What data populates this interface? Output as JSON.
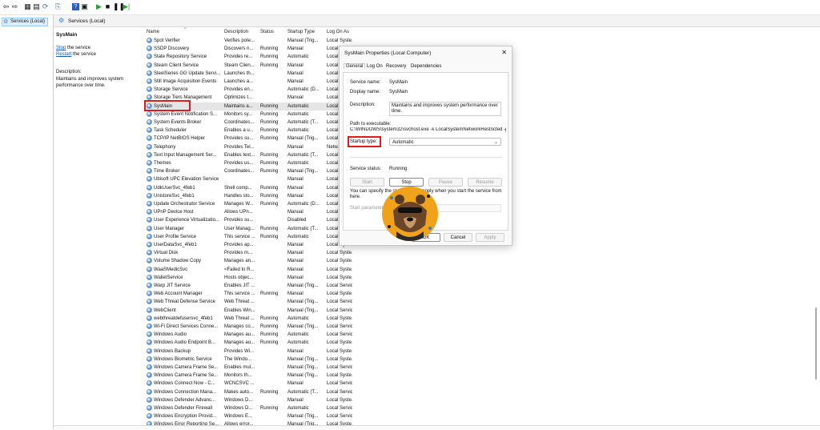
{
  "toolbar": {
    "icons": [
      "back-arrow-icon",
      "forward-arrow-icon",
      "console-tree-icon",
      "list-view-icon",
      "refresh-icon",
      "export-icon",
      "help-icon",
      "properties-icon",
      "play-icon",
      "stop-icon",
      "pause-icon",
      "resume-icon"
    ],
    "glyphs": [
      "⇦",
      "⇨",
      "▦",
      "▤",
      "⟳",
      "⎘",
      "?",
      "▣",
      "▶",
      "■",
      "❚❚",
      "▶|"
    ]
  },
  "tree": {
    "item_label": "Services (Local)"
  },
  "main": {
    "header_title": "Services (Local)"
  },
  "description_pane": {
    "service_title": "SysMain",
    "stop_link": "Stop",
    "stop_suffix": " the service",
    "restart_link": "Restart",
    "restart_suffix": " the service",
    "description_label": "Description:",
    "description_text": "Maintains and improves system performance over time."
  },
  "table": {
    "headers": {
      "name": "Name",
      "description": "Description",
      "status": "Status",
      "startup": "Startup Type",
      "logon": "Log On As"
    },
    "rows": [
      {
        "name": "Spot Verifier",
        "desc": "Verifies pote...",
        "status": "",
        "startup": "Manual (Trig...",
        "logon": "Local Syste..."
      },
      {
        "name": "SSDP Discovery",
        "desc": "Discovers n...",
        "status": "Running",
        "startup": "Manual",
        "logon": "Local Service"
      },
      {
        "name": "State Repository Service",
        "desc": "Provides re...",
        "status": "Running",
        "startup": "Automatic",
        "logon": "Local Syste..."
      },
      {
        "name": "Steam Client Service",
        "desc": "Steam Clien...",
        "status": "Running",
        "startup": "Manual",
        "logon": "Local Syste..."
      },
      {
        "name": "SteelSeries GG Update Servi...",
        "desc": "Launches th...",
        "status": "",
        "startup": "Manual",
        "logon": "Local Syste..."
      },
      {
        "name": "Still Image Acquisition Events",
        "desc": "Launches a...",
        "status": "",
        "startup": "Manual",
        "logon": "Local Syste..."
      },
      {
        "name": "Storage Service",
        "desc": "Provides en...",
        "status": "",
        "startup": "Automatic (D...",
        "logon": "Local Syste..."
      },
      {
        "name": "Storage Tiers Management",
        "desc": "Optimizes t...",
        "status": "",
        "startup": "Manual",
        "logon": "Local Syste..."
      },
      {
        "name": "SysMain",
        "desc": "Maintains a...",
        "status": "Running",
        "startup": "Automatic",
        "logon": "Local Syste..."
      },
      {
        "name": "System Event Notification S...",
        "desc": "Monitors sy...",
        "status": "Running",
        "startup": "Automatic",
        "logon": "Local Syste..."
      },
      {
        "name": "System Events Broker",
        "desc": "Coordinates...",
        "status": "Running",
        "startup": "Automatic (T...",
        "logon": "Local Syste..."
      },
      {
        "name": "Task Scheduler",
        "desc": "Enables a u...",
        "status": "Running",
        "startup": "Automatic",
        "logon": "Local Syste..."
      },
      {
        "name": "TCP/IP NetBIOS Helper",
        "desc": "Provides su...",
        "status": "Running",
        "startup": "Manual (Trig...",
        "logon": "Local Service"
      },
      {
        "name": "Telephony",
        "desc": "Provides Tel...",
        "status": "",
        "startup": "Manual",
        "logon": "Netw..."
      },
      {
        "name": "Text Input Management Ser...",
        "desc": "Enables text...",
        "status": "Running",
        "startup": "Automatic (T...",
        "logon": "Local Syste..."
      },
      {
        "name": "Themes",
        "desc": "Provides us...",
        "status": "Running",
        "startup": "Automatic",
        "logon": "Local Syste..."
      },
      {
        "name": "Time Broker",
        "desc": "Coordinates...",
        "status": "Running",
        "startup": "Manual (Trig...",
        "logon": "Local Service"
      },
      {
        "name": "Ubisoft UPC Elevation Service",
        "desc": "",
        "status": "",
        "startup": "Manual",
        "logon": "Local Syste..."
      },
      {
        "name": "UdkUserSvc_4feb1",
        "desc": "Shell comp...",
        "status": "Running",
        "startup": "Manual",
        "logon": "Local Syste..."
      },
      {
        "name": "UnistoreSvc_4feb1",
        "desc": "Handles sto...",
        "status": "Running",
        "startup": "Manual",
        "logon": "Local Syste..."
      },
      {
        "name": "Update Orchestrator Service",
        "desc": "Manages W...",
        "status": "Running",
        "startup": "Automatic (D...",
        "logon": "Local Syste..."
      },
      {
        "name": "UPnP Device Host",
        "desc": "Allows UPn...",
        "status": "",
        "startup": "Manual",
        "logon": "Local Service"
      },
      {
        "name": "User Experience Virtualizatio...",
        "desc": "Provides su...",
        "status": "",
        "startup": "Disabled",
        "logon": "Local Syste..."
      },
      {
        "name": "User Manager",
        "desc": "User Manag...",
        "status": "Running",
        "startup": "Automatic (T...",
        "logon": "Local Syste..."
      },
      {
        "name": "User Profile Service",
        "desc": "This service ...",
        "status": "Running",
        "startup": "Automatic",
        "logon": "Local Syste..."
      },
      {
        "name": "UserDataSvc_4feb1",
        "desc": "Provides ap...",
        "status": "",
        "startup": "Manual",
        "logon": "Local Syste..."
      },
      {
        "name": "Virtual Disk",
        "desc": "Provides m...",
        "status": "",
        "startup": "Manual",
        "logon": "Local Syste..."
      },
      {
        "name": "Volume Shadow Copy",
        "desc": "Manages an...",
        "status": "",
        "startup": "Manual",
        "logon": "Local Syste..."
      },
      {
        "name": "WaaSMedicSvc",
        "desc": "<Failed to R...",
        "status": "",
        "startup": "Manual",
        "logon": "Local Syste..."
      },
      {
        "name": "WalletService",
        "desc": "Hosts objec...",
        "status": "",
        "startup": "Manual",
        "logon": "Local Syste..."
      },
      {
        "name": "Warp JIT Service",
        "desc": "Enables JIT ...",
        "status": "",
        "startup": "Manual (Trig...",
        "logon": "Local Service"
      },
      {
        "name": "Web Account Manager",
        "desc": "This service ...",
        "status": "Running",
        "startup": "Manual",
        "logon": "Local Syste..."
      },
      {
        "name": "Web Threat Defense Service",
        "desc": "Web Threat ...",
        "status": "",
        "startup": "Manual (Trig...",
        "logon": "Local Service"
      },
      {
        "name": "WebClient",
        "desc": "Enables Win...",
        "status": "",
        "startup": "Manual (Trig...",
        "logon": "Local Service"
      },
      {
        "name": "webthreatdefusersvc_4feb1",
        "desc": "Web Threat ...",
        "status": "Running",
        "startup": "Automatic",
        "logon": "Local Syste..."
      },
      {
        "name": "Wi-Fi Direct Services Conne...",
        "desc": "Manages co...",
        "status": "Running",
        "startup": "Manual (Trig...",
        "logon": "Local Service"
      },
      {
        "name": "Windows Audio",
        "desc": "Manages au...",
        "status": "Running",
        "startup": "Automatic",
        "logon": "Local Service"
      },
      {
        "name": "Windows Audio Endpoint B...",
        "desc": "Manages au...",
        "status": "Running",
        "startup": "Automatic",
        "logon": "Local Syste..."
      },
      {
        "name": "Windows Backup",
        "desc": "Provides Wi...",
        "status": "",
        "startup": "Manual",
        "logon": "Local Syste..."
      },
      {
        "name": "Windows Biometric Service",
        "desc": "The Windo...",
        "status": "",
        "startup": "Manual (Trig...",
        "logon": "Local Syste..."
      },
      {
        "name": "Windows Camera Frame Se...",
        "desc": "Enables mul...",
        "status": "",
        "startup": "Manual (Trig...",
        "logon": "Local Service"
      },
      {
        "name": "Windows Camera Frame Se...",
        "desc": "Monitors th...",
        "status": "",
        "startup": "Manual (Trig...",
        "logon": "Local Syste..."
      },
      {
        "name": "Windows Connect Now - C...",
        "desc": "WCNCSVC ...",
        "status": "",
        "startup": "Manual",
        "logon": "Local Service"
      },
      {
        "name": "Windows Connection Mana...",
        "desc": "Makes auto...",
        "status": "Running",
        "startup": "Automatic (T...",
        "logon": "Local Service"
      },
      {
        "name": "Windows Defender Advanc...",
        "desc": "Windows D...",
        "status": "",
        "startup": "Manual",
        "logon": "Local Syste..."
      },
      {
        "name": "Windows Defender Firewall",
        "desc": "Windows D...",
        "status": "Running",
        "startup": "Automatic",
        "logon": "Local Service"
      },
      {
        "name": "Windows Encryption Provid...",
        "desc": "Windows E...",
        "status": "",
        "startup": "Manual (Trig...",
        "logon": "Local Service"
      },
      {
        "name": "Windows Error Reporting Se...",
        "desc": "Allows error...",
        "status": "",
        "startup": "Manual (Trig...",
        "logon": "Local Syste..."
      }
    ]
  },
  "dialog": {
    "title": "SysMain Properties (Local Computer)",
    "tabs": [
      "General",
      "Log On",
      "Recovery",
      "Dependencies"
    ],
    "service_name_label": "Service name:",
    "service_name": "SysMain",
    "display_name_label": "Display name:",
    "display_name": "SysMain",
    "description_label": "Description:",
    "description": "Maintains and improves system performance over time.",
    "path_label": "Path to executable:",
    "path": "C:\\WINDOWS\\system32\\svchost.exe -k LocalSystemNetworkRestricted -p",
    "startup_label": "Startup type:",
    "startup_value": "Automatic",
    "status_label": "Service status:",
    "status_value": "Running",
    "btn_start": "Start",
    "btn_stop": "Stop",
    "btn_pause": "Pause",
    "btn_resume": "Resume",
    "note_start": "You can specify the st",
    "note_end": "apply when you start the service from here.",
    "params_label": "Start parameters:",
    "ok": "OK",
    "cancel": "Cancel",
    "apply": "Apply"
  },
  "colors": {
    "highlight_red": "#e01b1b",
    "logo_orange": "#f0a21a",
    "link_blue": "#1a56c8"
  }
}
